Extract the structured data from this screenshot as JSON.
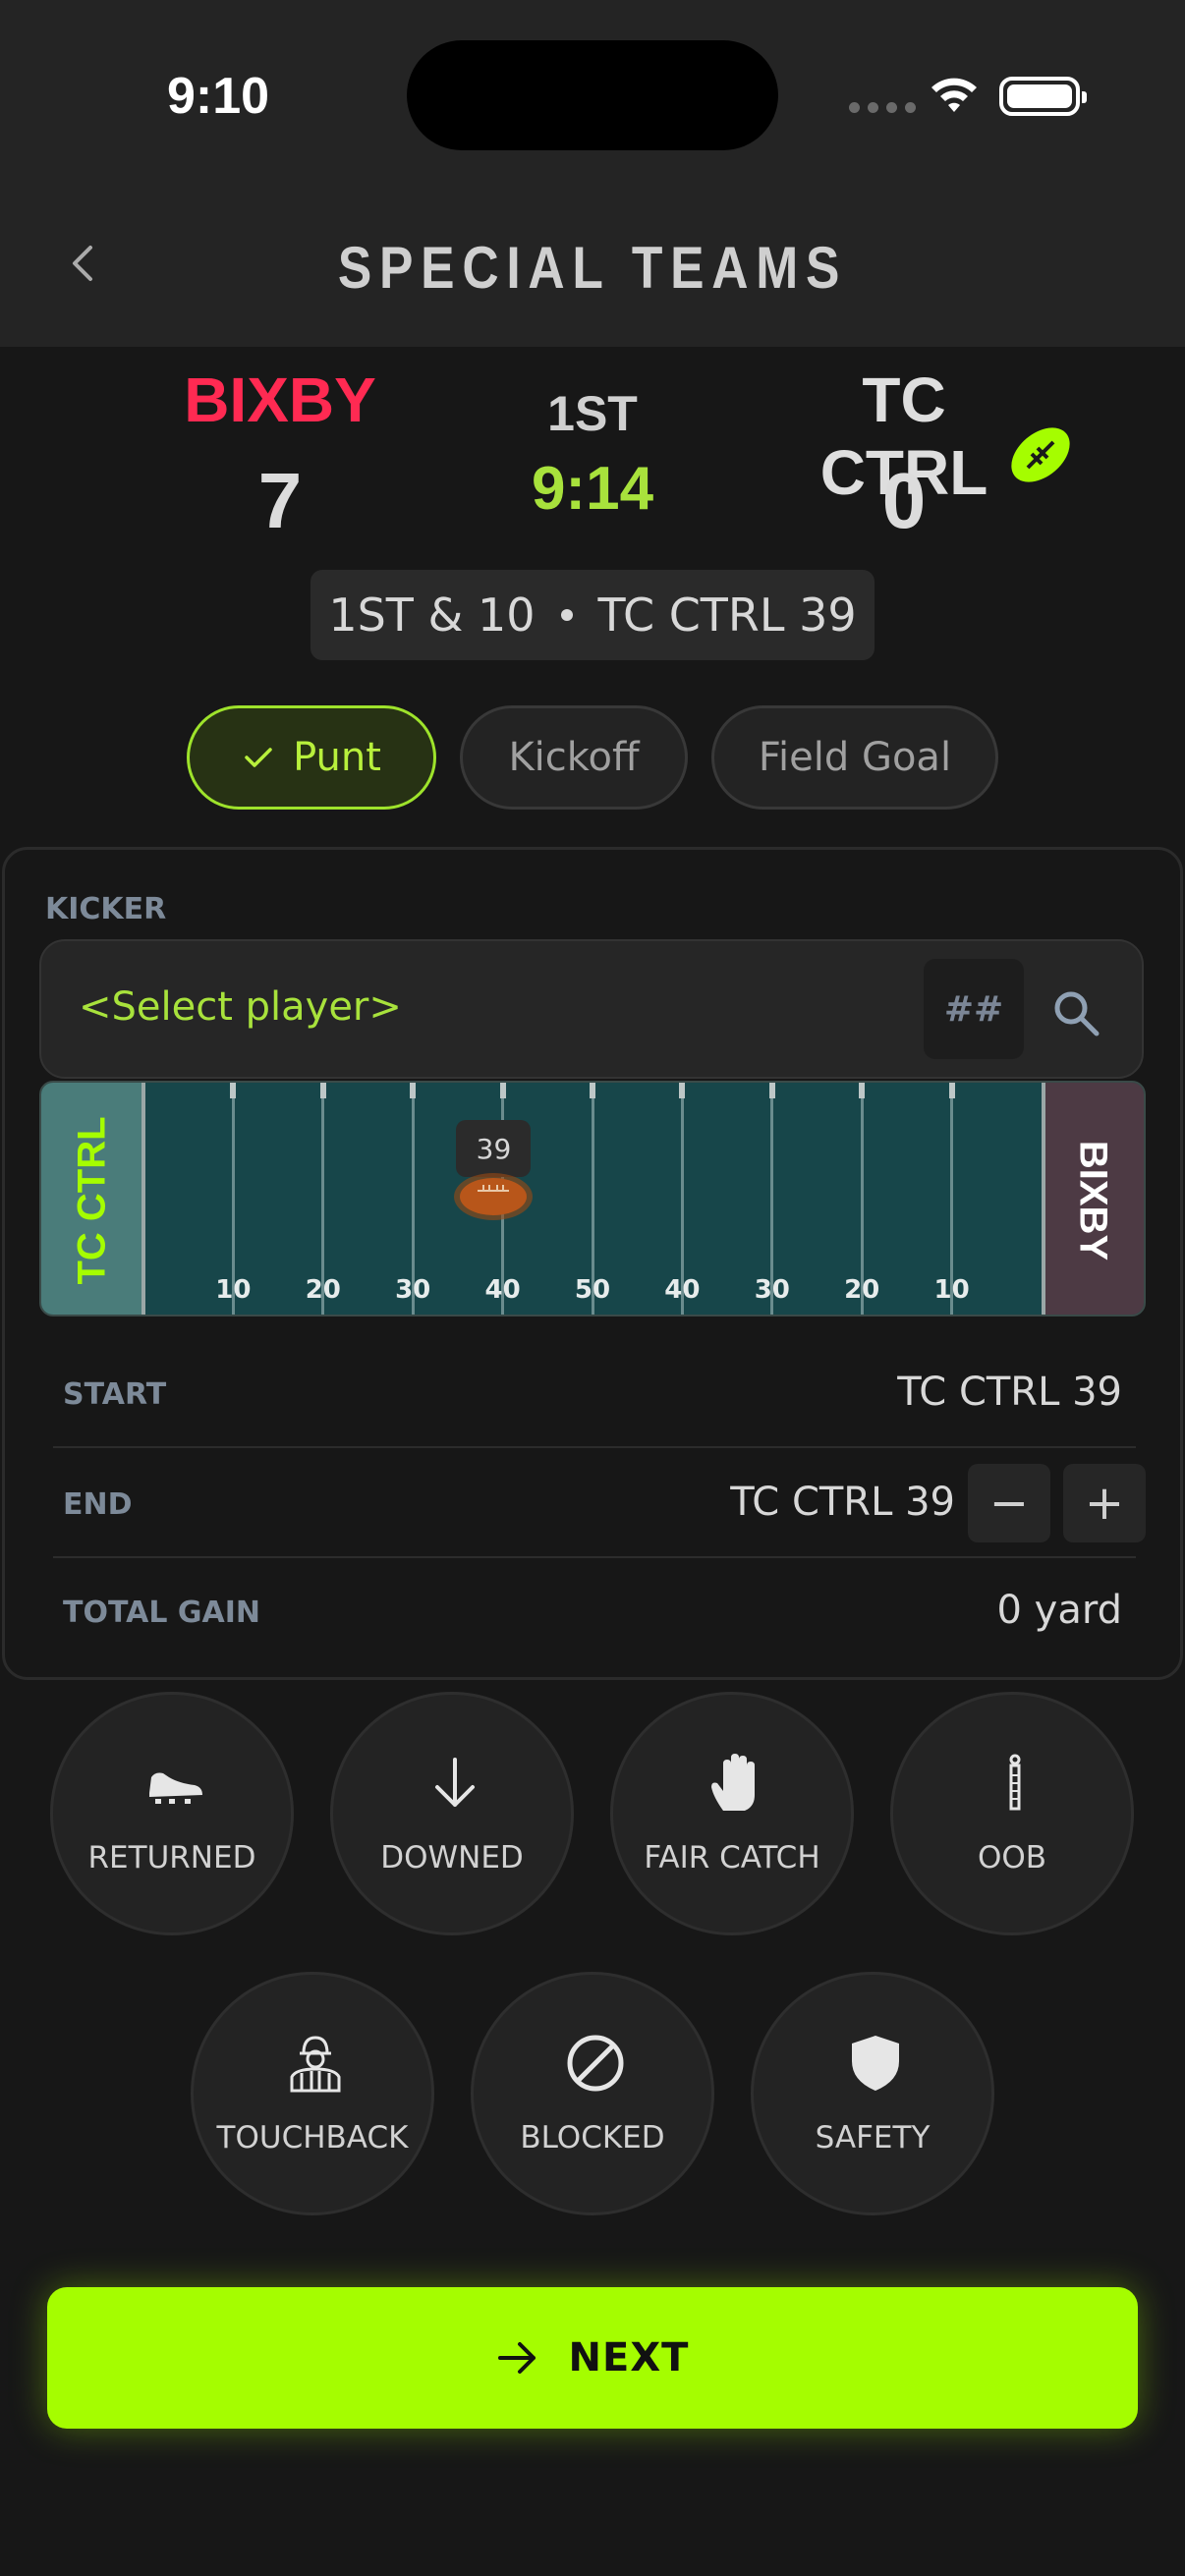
{
  "status_bar": {
    "time": "9:10"
  },
  "header": {
    "title": "SPECIAL TEAMS"
  },
  "scoreboard": {
    "home_team": "BIXBY",
    "home_score": "7",
    "period": "1ST",
    "clock": "9:14",
    "away_team": "TC CTRL",
    "away_score": "0",
    "home_color": "#ff2a52",
    "accent_color": "#a8e23c"
  },
  "down_distance": {
    "down": "1ST & 10",
    "spot": "TC CTRL 39"
  },
  "play_types": [
    {
      "label": "Punt",
      "selected": true
    },
    {
      "label": "Kickoff",
      "selected": false
    },
    {
      "label": "Field Goal",
      "selected": false
    }
  ],
  "kicker": {
    "label": "KICKER",
    "placeholder": "<Select player>",
    "number_button": "##",
    "search_icon": "search-icon"
  },
  "field": {
    "left_endzone": "TC CTRL",
    "right_endzone": "BIXBY",
    "yard_labels": [
      "10",
      "20",
      "30",
      "40",
      "50",
      "40",
      "30",
      "20",
      "10"
    ],
    "ball_marker": "39",
    "ball_position_yards": 39
  },
  "rows": {
    "start_label": "START",
    "start_value": "TC CTRL 39",
    "end_label": "END",
    "end_value": "TC CTRL 39",
    "minus": "−",
    "plus": "+",
    "gain_label": "TOTAL GAIN",
    "gain_value": "0 yard"
  },
  "outcomes": [
    {
      "label": "RETURNED",
      "icon": "cleat-icon"
    },
    {
      "label": "DOWNED",
      "icon": "arrow-down-icon"
    },
    {
      "label": "FAIR CATCH",
      "icon": "hand-icon"
    },
    {
      "label": "OOB",
      "icon": "pylon-icon"
    },
    {
      "label": "TOUCHBACK",
      "icon": "referee-icon"
    },
    {
      "label": "BLOCKED",
      "icon": "blocked-icon"
    },
    {
      "label": "SAFETY",
      "icon": "shield-icon"
    }
  ],
  "next_button": {
    "label": "NEXT",
    "icon": "arrow-right-icon",
    "color": "#a5fd00"
  }
}
